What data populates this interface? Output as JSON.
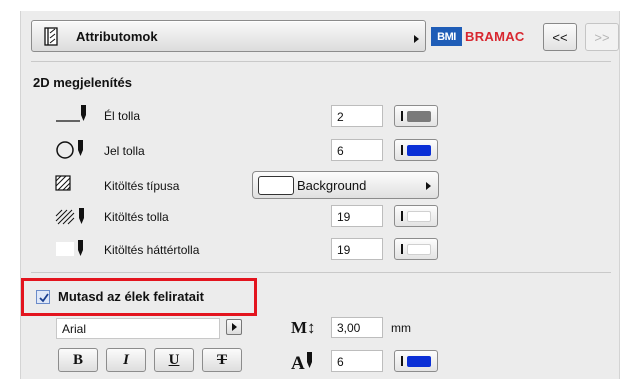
{
  "header": {
    "dropdown_title": "Attributomok",
    "logo_bmi": "BMI",
    "logo_bramac": "BRAMAC",
    "prev_label": "<<",
    "next_label": ">>"
  },
  "section_2d": {
    "title": "2D megjelenítés",
    "rows": [
      {
        "label": "Él tolla",
        "value": "2",
        "pen_color": "#7a7a7a",
        "icon": "edge-pen-icon"
      },
      {
        "label": "Jel tolla",
        "value": "6",
        "pen_color": "#0a2fd6",
        "icon": "symbol-pen-icon"
      },
      {
        "label": "Kitöltés típusa",
        "icon": "fill-type-icon"
      },
      {
        "label": "Kitöltés tolla",
        "value": "19",
        "pen_color": "#ffffff",
        "icon": "fill-pen-icon"
      },
      {
        "label": "Kitöltés háttértolla",
        "value": "19",
        "pen_color": "#ffffff",
        "icon": "fill-background-pen-icon"
      }
    ],
    "fill_type_value": "Background"
  },
  "labels_section": {
    "checkbox_label": "Mutasd az élek feliratait",
    "checked": true,
    "font_name": "Arial",
    "style_buttons": [
      "B",
      "I",
      "U",
      "T"
    ],
    "size_value": "3,00",
    "size_unit": "mm",
    "text_pen_value": "6",
    "text_pen_color": "#0a2fd6"
  },
  "colors": {
    "highlight": "#e3141e",
    "bmi_blue": "#1f5db7",
    "bramac_red": "#d8262f"
  }
}
